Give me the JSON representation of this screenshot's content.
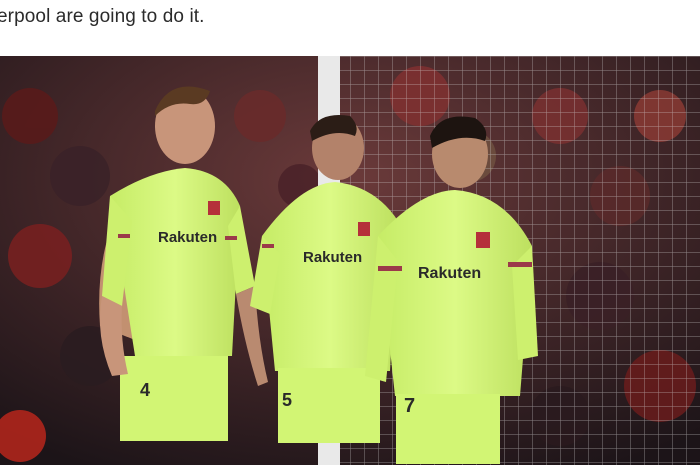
{
  "article": {
    "previous_line_fragments": [
      "",
      ""
    ],
    "text_line": "erpool are going to do it."
  },
  "photo": {
    "jersey_sponsor": "Rakuten",
    "shirt_numbers": [
      "4",
      "5",
      "7"
    ],
    "colors": {
      "kit": "#d4f57a",
      "kit_shadow": "#b9dc5e",
      "crowd_red": "#7a1e1e",
      "crowd_dark": "#2a1f24",
      "goal_net": "#cfcfcf"
    }
  }
}
